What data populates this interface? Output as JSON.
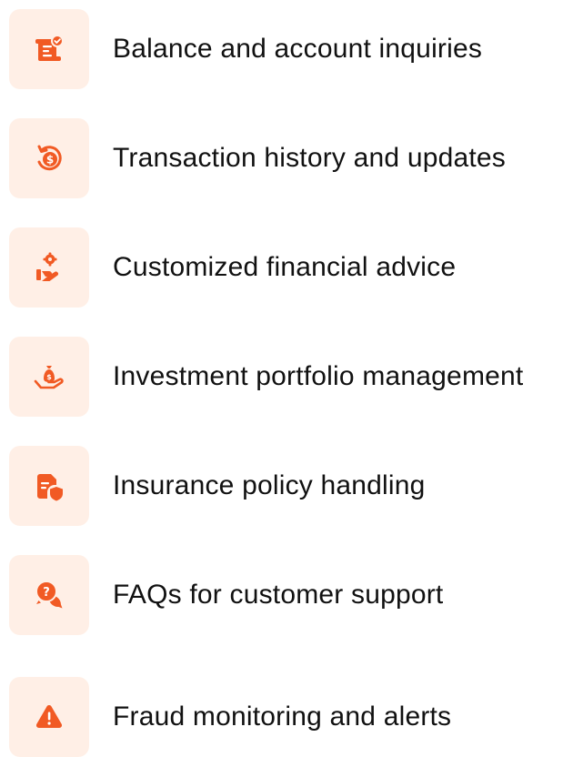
{
  "accent_color": "#F15A24",
  "tile_color": "#FFEFE6",
  "text_color": "#111111",
  "features": [
    {
      "label": "Balance and account inquiries",
      "icon": "scroll-checkmark-icon"
    },
    {
      "label": "Transaction history and updates",
      "icon": "refresh-dollar-icon"
    },
    {
      "label": "Customized financial advice",
      "icon": "hand-gear-icon"
    },
    {
      "label": "Investment portfolio management",
      "icon": "hand-money-bag-icon"
    },
    {
      "label": "Insurance policy handling",
      "icon": "document-shield-icon"
    },
    {
      "label": "FAQs for customer support",
      "icon": "question-chat-icon"
    },
    {
      "label": "Fraud monitoring and alerts",
      "icon": "warning-triangle-icon"
    }
  ]
}
